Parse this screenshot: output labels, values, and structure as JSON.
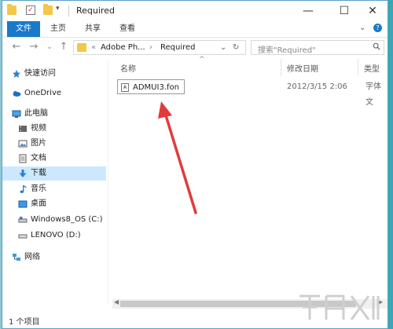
{
  "window": {
    "title": "Required",
    "controls": {
      "minimize": "—",
      "maximize": "☐",
      "close": "✕"
    }
  },
  "ribbon": {
    "tabs": [
      "文件",
      "主页",
      "共享",
      "查看"
    ]
  },
  "address": {
    "breadcrumbs": [
      "«",
      "Adobe Ph...",
      "›",
      "Required"
    ],
    "search_placeholder": "搜索\"Required\""
  },
  "nav": {
    "items": [
      {
        "label": "快速访问",
        "icon": "star-icon"
      },
      {
        "label": "OneDrive",
        "icon": "cloud-icon"
      },
      {
        "label": "此电脑",
        "icon": "computer-icon"
      },
      {
        "label": "视频",
        "icon": "video-icon"
      },
      {
        "label": "图片",
        "icon": "pictures-icon"
      },
      {
        "label": "文档",
        "icon": "documents-icon"
      },
      {
        "label": "下载",
        "icon": "download-icon",
        "selected": true
      },
      {
        "label": "音乐",
        "icon": "music-icon"
      },
      {
        "label": "桌面",
        "icon": "desktop-icon"
      },
      {
        "label": "Windows8_OS (C:)",
        "icon": "drive-icon"
      },
      {
        "label": "LENOVO (D:)",
        "icon": "drive-icon"
      },
      {
        "label": "网络",
        "icon": "network-icon"
      }
    ]
  },
  "columns": {
    "name": "名称",
    "modified": "修改日期",
    "type": "类型"
  },
  "files": [
    {
      "name": "ADMUI3.fon",
      "modified": "2012/3/15 2:06",
      "type": "字体文"
    }
  ],
  "status": {
    "count": "1 个项目"
  },
  "colors": {
    "accent": "#1979ca",
    "selection": "#cce8ff",
    "arrow": "#e23b3b"
  }
}
